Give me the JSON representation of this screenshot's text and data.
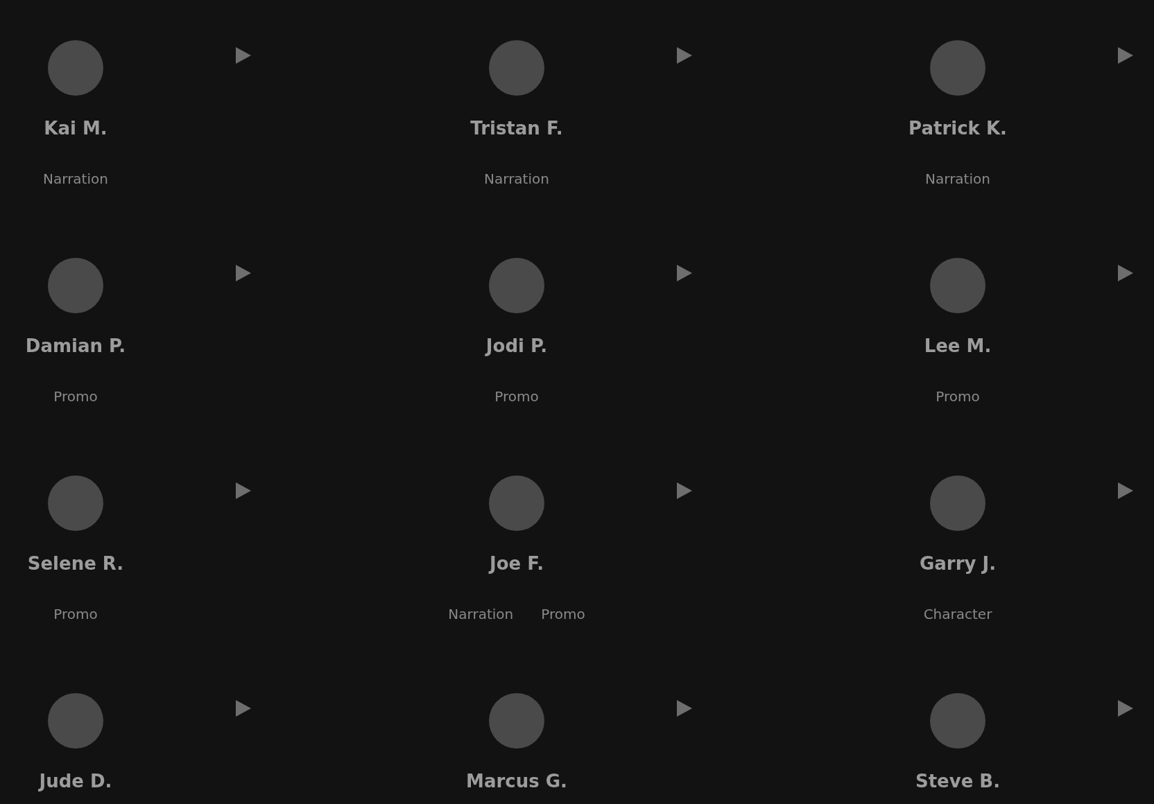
{
  "actors": [
    {
      "name": "Kai M.",
      "tags": [
        "Narration"
      ]
    },
    {
      "name": "Tristan F.",
      "tags": [
        "Narration"
      ]
    },
    {
      "name": "Patrick K.",
      "tags": [
        "Narration"
      ]
    },
    {
      "name": "Damian P.",
      "tags": [
        "Promo"
      ]
    },
    {
      "name": "Jodi P.",
      "tags": [
        "Promo"
      ]
    },
    {
      "name": "Lee M.",
      "tags": [
        "Promo"
      ]
    },
    {
      "name": "Selene R.",
      "tags": [
        "Promo"
      ]
    },
    {
      "name": "Joe F.",
      "tags": [
        "Narration",
        "Promo"
      ]
    },
    {
      "name": "Garry J.",
      "tags": [
        "Character"
      ]
    },
    {
      "name": "Jude D."
    },
    {
      "name": "Marcus G."
    },
    {
      "name": "Steve B."
    }
  ]
}
